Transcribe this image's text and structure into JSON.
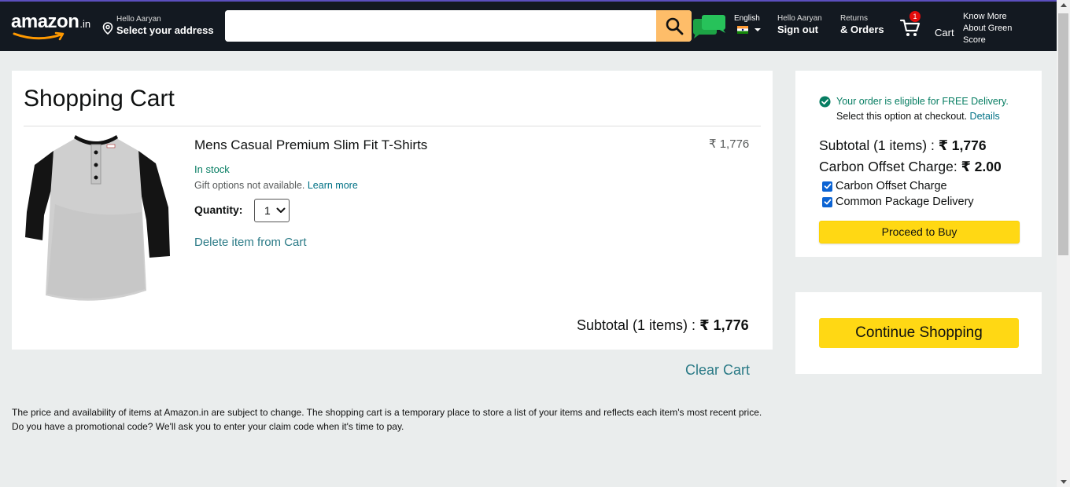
{
  "header": {
    "logo_text": "amazon",
    "logo_suffix": ".in",
    "address_greeting": "Hello Aaryan",
    "address_label": "Select your address",
    "search_value": "",
    "language": "English",
    "account_greeting": "Hello Aaryan",
    "account_action": "Sign out",
    "returns_label": "Returns",
    "orders_label": "& Orders",
    "cart_count": "1",
    "cart_label": "Cart",
    "green_line1": "Know More",
    "green_line2": "About Green",
    "green_line3": "Score"
  },
  "cart": {
    "title": "Shopping Cart",
    "item": {
      "name": "Mens Casual Premium Slim Fit T-Shirts",
      "price": "₹ 1,776",
      "stock": "In stock",
      "gift_text": "Gift options not available.",
      "gift_link": "Learn more",
      "quantity_label": "Quantity:",
      "quantity_value": "1",
      "delete_label": "Delete item from Cart"
    },
    "subtotal_label": "Subtotal (1 items) : ",
    "subtotal_value": "₹ 1,776",
    "clear_label": "Clear Cart"
  },
  "footnote": {
    "line1": "The price and availability of items at Amazon.in are subject to change. The shopping cart is a temporary place to store a list of your items and reflects each item's most recent price.",
    "line2": "Do you have a promotional code? We'll ask you to enter your claim code when it's time to pay."
  },
  "checkout": {
    "eligible_text": "Your order is eligible for FREE Delivery.",
    "select_text": "Select this option at checkout. ",
    "details_link": "Details",
    "subtotal_label": "Subtotal (1 items) : ",
    "subtotal_value": "₹ 1,776",
    "carbon_label": "Carbon Offset Charge: ",
    "carbon_value": "₹ 2.00",
    "option1": "Carbon Offset Charge",
    "option2": "Common Package Delivery",
    "proceed_label": "Proceed to Buy",
    "continue_label": "Continue Shopping"
  },
  "colors": {
    "header_bg": "#131921",
    "search_button": "#febd69",
    "buy_button": "#ffd814",
    "link": "#007185",
    "success": "#067d62",
    "badge": "#e40b0b"
  }
}
